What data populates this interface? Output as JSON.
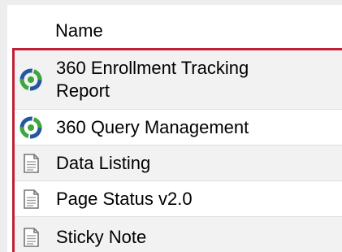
{
  "header": {
    "column_label": "Name"
  },
  "items": [
    {
      "label": "360 Enrollment Tracking Report",
      "icon": "circular-arrows-icon",
      "background": "gray"
    },
    {
      "label": "360 Query Management",
      "icon": "circular-arrows-icon",
      "background": "white"
    },
    {
      "label": "Data Listing",
      "icon": "document-icon",
      "background": "gray"
    },
    {
      "label": "Page Status v2.0",
      "icon": "document-icon",
      "background": "white"
    },
    {
      "label": "Sticky Note",
      "icon": "document-icon",
      "background": "gray"
    }
  ],
  "colors": {
    "highlight_border": "#c11f33",
    "icon_ring_blue": "#2457a3",
    "icon_ring_green": "#3fa63c",
    "row_alt": "#f2f2f2"
  }
}
